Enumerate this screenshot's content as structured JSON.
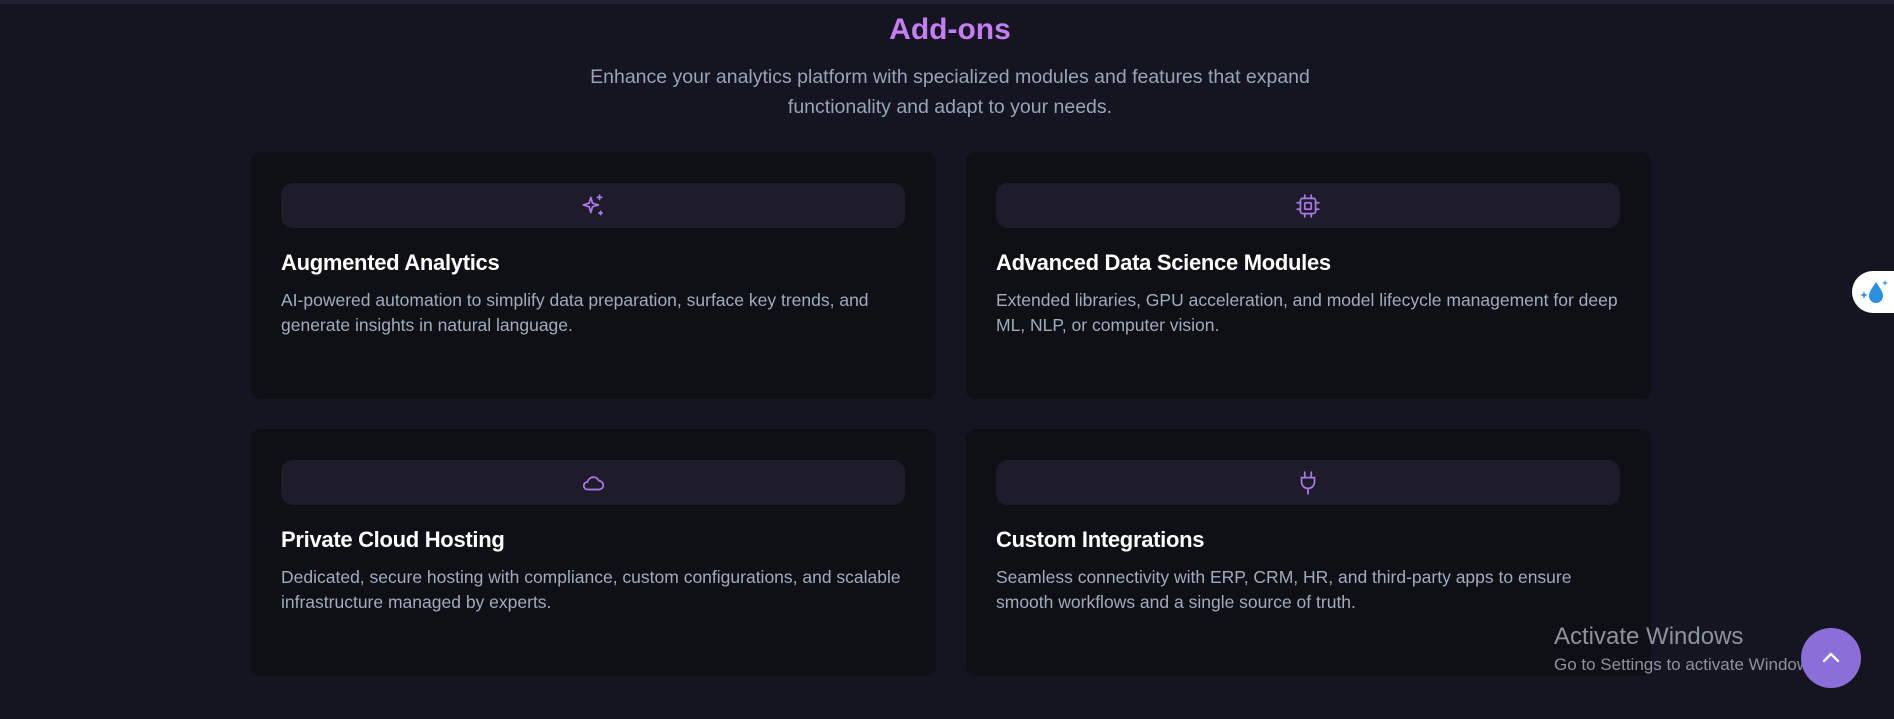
{
  "header": {
    "title": "Add-ons",
    "subtitle": "Enhance your analytics platform with specialized modules and features that expand functionality and adapt to your needs."
  },
  "colors": {
    "accent": "#c57df2",
    "icon": "#a97ae8",
    "background": "#141520",
    "card": "#0f0f16"
  },
  "cards": [
    {
      "icon": "sparkles-icon",
      "title": "Augmented Analytics",
      "description": "AI-powered automation to simplify data preparation, surface key trends, and generate insights in natural language."
    },
    {
      "icon": "cpu-chip-icon",
      "title": "Advanced Data Science Modules",
      "description": "Extended libraries, GPU acceleration, and model lifecycle management for deep ML, NLP, or computer vision."
    },
    {
      "icon": "cloud-icon",
      "title": "Private Cloud Hosting",
      "description": "Dedicated, secure hosting with compliance, custom configurations, and scalable infrastructure managed by experts."
    },
    {
      "icon": "plug-icon",
      "title": "Custom Integrations",
      "description": "Seamless connectivity with ERP, CRM, HR, and third-party apps to ensure smooth workflows and a single source of truth."
    }
  ],
  "overlay": {
    "activate_title": "Activate Windows",
    "activate_subtitle": "Go to Settings to activate Windows."
  }
}
